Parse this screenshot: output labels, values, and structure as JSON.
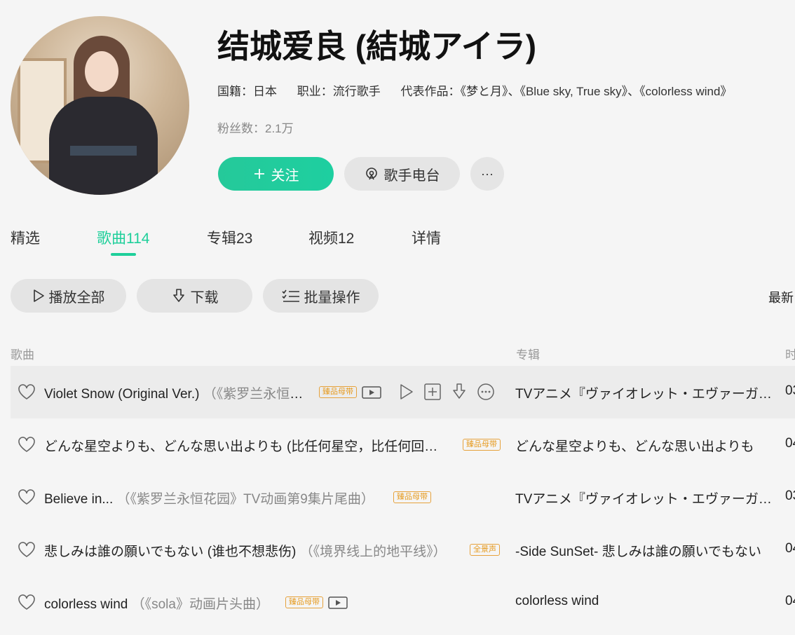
{
  "artist": {
    "name": "结城爱良 (結城アイラ)",
    "nationality": "国籍：日本",
    "occupation": "职业：流行歌手",
    "works": "代表作品：《梦と月》、《Blue sky, True sky》、《colorless wind》",
    "fans": "粉丝数：2.1万"
  },
  "buttons": {
    "follow": "关注",
    "radio": "歌手电台",
    "more": "···"
  },
  "tabs": [
    {
      "label": "精选"
    },
    {
      "label": "歌曲114"
    },
    {
      "label": "专辑23"
    },
    {
      "label": "视频12"
    },
    {
      "label": "详情"
    }
  ],
  "actions": {
    "play_all": "播放全部",
    "download": "下载",
    "batch": "批量操作",
    "sort": "最新"
  },
  "columns": {
    "song": "歌曲",
    "album": "专辑",
    "duration": "时"
  },
  "songs": [
    {
      "title": "Violet Snow (Original Ver.)",
      "sub": "（《紫罗兰永恒花园》TV动画插曲）",
      "badge": "臻品母带",
      "album": "TVアニメ『ヴァイオレット・エヴァーガーデン』",
      "duration": "03"
    },
    {
      "title": "どんな星空よりも、どんな思い出よりも (比任何星空，比任何回忆都)",
      "sub": "",
      "badge": "臻品母带",
      "album": "どんな星空よりも、どんな思い出よりも",
      "duration": "04"
    },
    {
      "title": "Believe in...",
      "sub": "（《紫罗兰永恒花园》TV动画第9集片尾曲）",
      "badge": "臻品母带",
      "album": "TVアニメ『ヴァイオレット・エヴァーガーデン』",
      "duration": "03"
    },
    {
      "title": "悲しみは誰の願いでもない (谁也不想悲伤)",
      "sub": "（《境界线上的地平线》）",
      "badge": "全景声",
      "album": "-Side SunSet- 悲しみは誰の願いでもない",
      "duration": "04"
    },
    {
      "title": "colorless wind",
      "sub": "（《sola》动画片头曲）",
      "badge": "臻品母带",
      "album": "colorless wind",
      "duration": "04"
    }
  ],
  "colors": {
    "accent": "#1ecf9a",
    "badge": "#e69c22"
  }
}
